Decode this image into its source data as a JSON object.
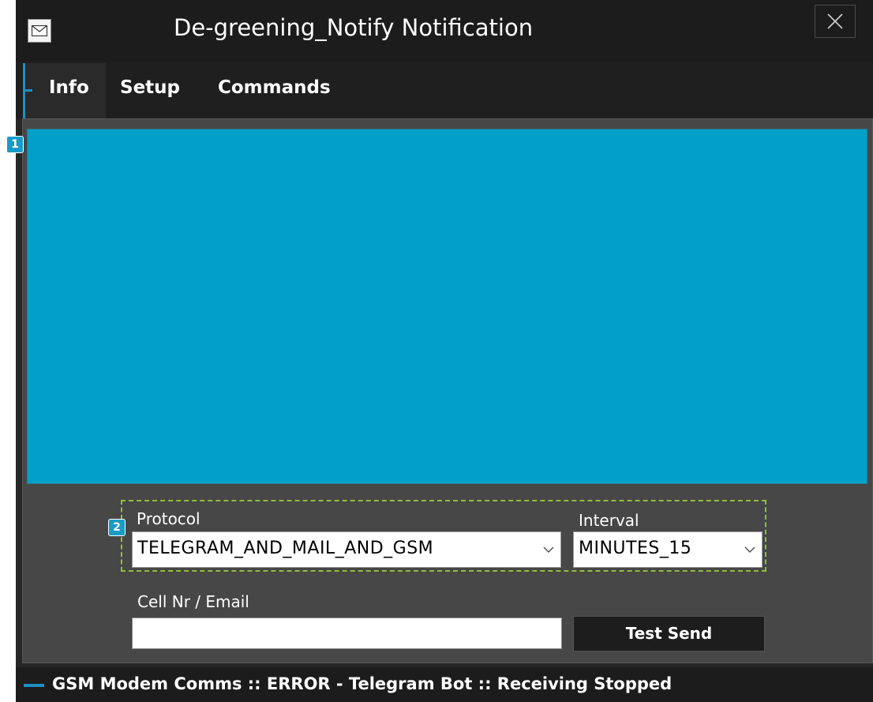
{
  "window": {
    "title": "De-greening_Notify Notification"
  },
  "tabs": [
    {
      "label": "Info",
      "active": true
    },
    {
      "label": "Setup",
      "active": false
    },
    {
      "label": "Commands",
      "active": false
    }
  ],
  "badges": {
    "info_panel": "1",
    "settings_group": "2"
  },
  "form": {
    "protocol_label": "Protocol",
    "protocol_value": "TELEGRAM_AND_MAIL_AND_GSM",
    "interval_label": "Interval",
    "interval_value": "MINUTES_15",
    "contact_label": "Cell Nr / Email",
    "contact_value": "",
    "test_send_label": "Test Send"
  },
  "status": {
    "text": "GSM Modem Comms :: ERROR - Telegram Bot :: Receiving Stopped"
  },
  "colors": {
    "accent": "#1e8fc0",
    "info_panel": "#00a0c8",
    "group_border": "#8fbf3a",
    "background": "#474747"
  }
}
